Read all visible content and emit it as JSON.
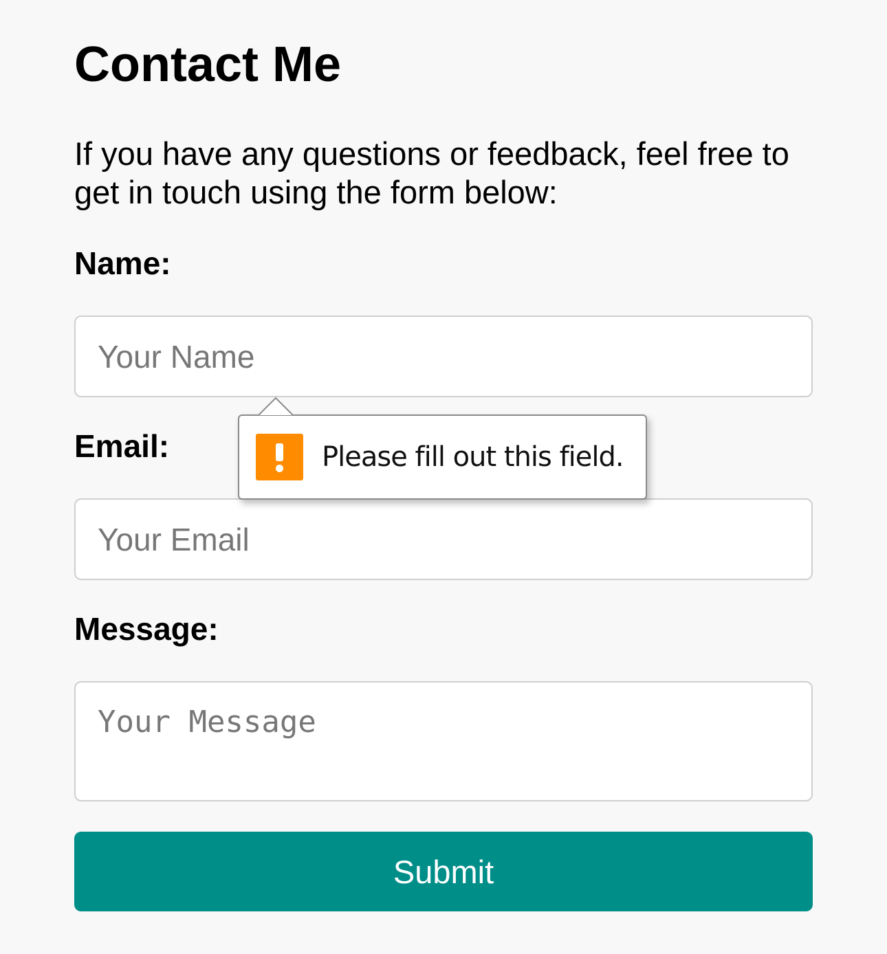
{
  "page": {
    "title": "Contact Me",
    "intro": "If you have any questions or feedback, feel free to get in touch using the form below:"
  },
  "form": {
    "name_label": "Name:",
    "name_placeholder": "Your Name",
    "email_label": "Email:",
    "email_placeholder": "Your Email",
    "message_label": "Message:",
    "message_placeholder": "Your Message",
    "submit_label": "Submit"
  },
  "validation_tooltip": {
    "icon": "warning-icon",
    "message": "Please fill out this field."
  },
  "colors": {
    "background": "#f8f8f8",
    "submit_button": "#008e89",
    "warning_icon": "#ff8c00",
    "input_border": "#cfcfcf"
  }
}
